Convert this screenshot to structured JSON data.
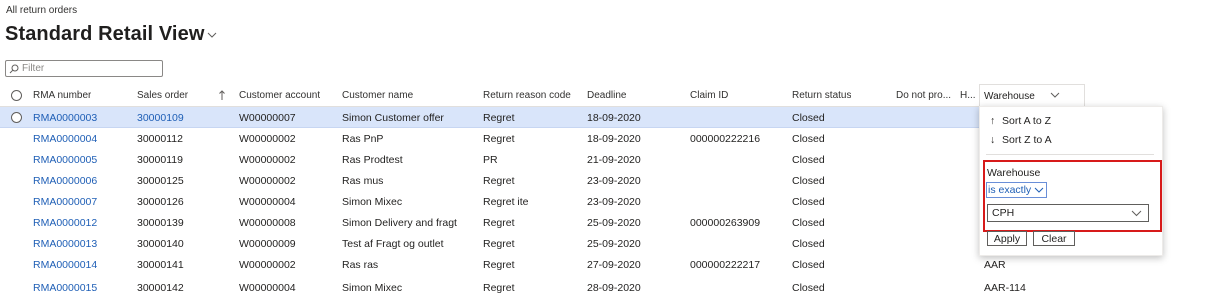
{
  "breadcrumb": "All return orders",
  "view_title": "Standard Retail View",
  "filter": {
    "placeholder": "Filter"
  },
  "columns": {
    "rma": "RMA number",
    "sales_order": "Sales order",
    "customer_account": "Customer account",
    "customer_name": "Customer name",
    "return_reason": "Return reason code",
    "deadline": "Deadline",
    "claim_id": "Claim ID",
    "return_status": "Return status",
    "do_not_process": "Do not pro...",
    "h": "H...",
    "warehouse": "Warehouse"
  },
  "rows": [
    {
      "rma": "RMA0000003",
      "sales_order": "30000109",
      "account": "W00000007",
      "name": "Simon Customer offer",
      "reason": "Regret",
      "deadline": "18-09-2020",
      "claim": "",
      "status": "Closed",
      "warehouse": ""
    },
    {
      "rma": "RMA0000004",
      "sales_order": "30000112",
      "account": "W00000002",
      "name": "Ras PnP",
      "reason": "Regret",
      "deadline": "18-09-2020",
      "claim": "000000222216",
      "status": "Closed",
      "warehouse": ""
    },
    {
      "rma": "RMA0000005",
      "sales_order": "30000119",
      "account": "W00000002",
      "name": "Ras Prodtest",
      "reason": "PR",
      "deadline": "21-09-2020",
      "claim": "",
      "status": "Closed",
      "warehouse": ""
    },
    {
      "rma": "RMA0000006",
      "sales_order": "30000125",
      "account": "W00000002",
      "name": "Ras mus",
      "reason": "Regret",
      "deadline": "23-09-2020",
      "claim": "",
      "status": "Closed",
      "warehouse": ""
    },
    {
      "rma": "RMA0000007",
      "sales_order": "30000126",
      "account": "W00000004",
      "name": "Simon Mixec",
      "reason": "Regret ite",
      "deadline": "23-09-2020",
      "claim": "",
      "status": "Closed",
      "warehouse": ""
    },
    {
      "rma": "RMA0000012",
      "sales_order": "30000139",
      "account": "W00000008",
      "name": "Simon Delivery and fragt",
      "reason": "Regret",
      "deadline": "25-09-2020",
      "claim": "000000263909",
      "status": "Closed",
      "warehouse": ""
    },
    {
      "rma": "RMA0000013",
      "sales_order": "30000140",
      "account": "W00000009",
      "name": "Test af Fragt og outlet",
      "reason": "Regret",
      "deadline": "25-09-2020",
      "claim": "",
      "status": "Closed",
      "warehouse": ""
    },
    {
      "rma": "RMA0000014",
      "sales_order": "30000141",
      "account": "W00000002",
      "name": "Ras ras",
      "reason": "Regret",
      "deadline": "27-09-2020",
      "claim": "000000222217",
      "status": "Closed",
      "warehouse": "AAR"
    },
    {
      "rma": "RMA0000015",
      "sales_order": "30000142",
      "account": "W00000004",
      "name": "Simon Mixec",
      "reason": "Regret",
      "deadline": "28-09-2020",
      "claim": "",
      "status": "Closed",
      "warehouse": "AAR-114"
    }
  ],
  "dropdown": {
    "sort_asc": "Sort A to Z",
    "sort_desc": "Sort Z to A",
    "field_label": "Warehouse",
    "operator": "is exactly",
    "value": "CPH",
    "apply": "Apply",
    "clear": "Clear"
  },
  "colors": {
    "link": "#1f5fb6",
    "selected_row": "#d9e5fa",
    "highlight_border": "#d71a1a"
  }
}
